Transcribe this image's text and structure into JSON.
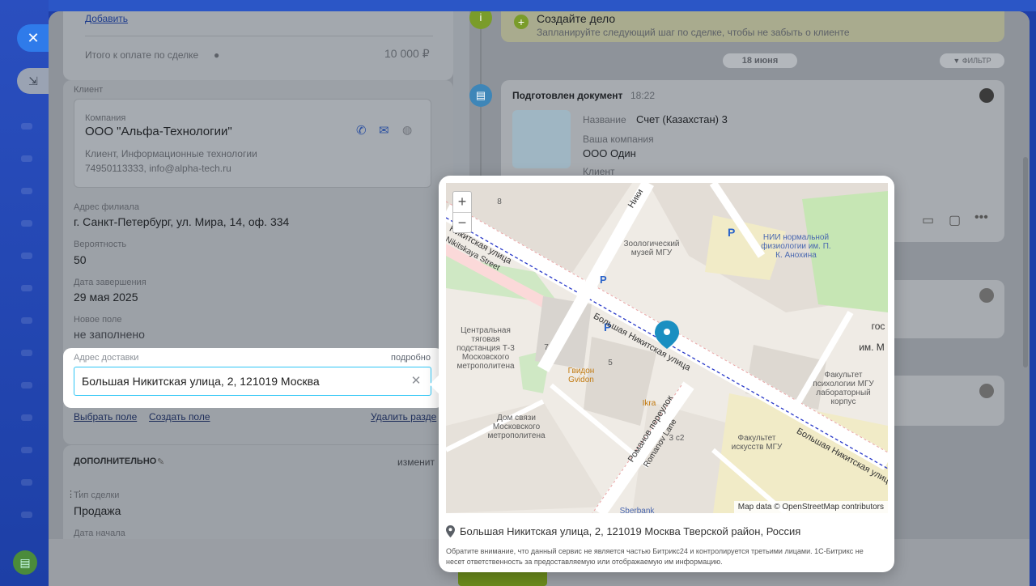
{
  "crm": {
    "add_link": "Добавить",
    "total_label": "Итого к оплате по сделке",
    "total_value": "10 000 ₽",
    "client_section": "Клиент",
    "company_label": "Компания",
    "company_name": "ООО \"Альфа-Технологии\"",
    "company_type": "Клиент, Информационные технологии",
    "company_contacts": "74950113333, info@alpha-tech.ru",
    "branch_label": "Адрес филиала",
    "branch_value": "г. Санкт-Петербург, ул. Мира, 14, оф. 334",
    "probability_label": "Вероятность",
    "probability_value": "50",
    "close_date_label": "Дата завершения",
    "close_date_value": "29 мая 2025",
    "new_field_label": "Новое поле",
    "new_field_value": "не заполнено",
    "delivery_label": "Адрес доставки",
    "delivery_more": "подробно",
    "delivery_value": "Большая Никитская улица, 2, 121019 Москва",
    "choose_field": "Выбрать поле",
    "create_field": "Создать поле",
    "delete_section": "Удалить разде",
    "additional_title": "ДОПОЛНИТЕЛЬНО",
    "change_link": "изменит",
    "deal_type_label": "Тип сделки",
    "deal_type_value": "Продажа",
    "start_date_label": "Дата начала"
  },
  "timeline": {
    "todo_title": "Создайте дело",
    "todo_hint": "Запланируйте следующий шаг по сделке, чтобы не забыть о клиенте",
    "date_badge": "18 июня",
    "filter_label": "ФИЛЬТР",
    "doc_title": "Подготовлен документ",
    "doc_time": "18:22",
    "name_label": "Название",
    "name_value": "Счет (Казахстан) 3",
    "company_label": "Ваша компания",
    "company_value": "ООО Один",
    "client_label": "Клиент"
  },
  "map_popup": {
    "zoom_in": "+",
    "zoom_out": "−",
    "attribution": "Map data © OpenStreetMap contributors",
    "address": "Большая Никитская улица, 2, 121019 Москва Тверской район, Россия",
    "notice": "Обратите внимание, что данный сервис не является частью Битрикс24 и контролируется третьими лицами. 1С-Битрикс не несет ответственность за предоставляемую или отображаемую им информацию.",
    "labels": {
      "nikitskaya_ru": "Никитская улица",
      "nikitskaya_en": "Nikitskaya Street",
      "bn_upper": "Большая Никитская улица",
      "bn_lower": "Большая Никитская улица",
      "romanov": "Романов переулок",
      "romanov_en": "Romanov Lane",
      "zoo_museum": "Зоологический музей МГУ",
      "nii": "НИИ нормальной физиологии им. П. К. Анохина",
      "central_library": "Центральная тяговая подстанция Т-3 Московского метрополитена",
      "gvidon": "Гвидон Gvidon",
      "ikra": "Ikra",
      "dom_svyazi": "Дом связи Московского метрополитена",
      "psych": "Факультет психологии МГУ лабораторный корпус",
      "arts": "Факультет искусств МГУ",
      "sberbank": "Sberbank",
      "house_7": "7",
      "house_5": "5",
      "house_8": "8",
      "house_3c2": "3 с2",
      "partial_top": "Ники",
      "partial_right1": "гос",
      "partial_right2": "им. М"
    }
  },
  "colors": {
    "accent": "#2fc6f6",
    "pin": "#1a8fc1",
    "rail": "#1f3fa8"
  }
}
